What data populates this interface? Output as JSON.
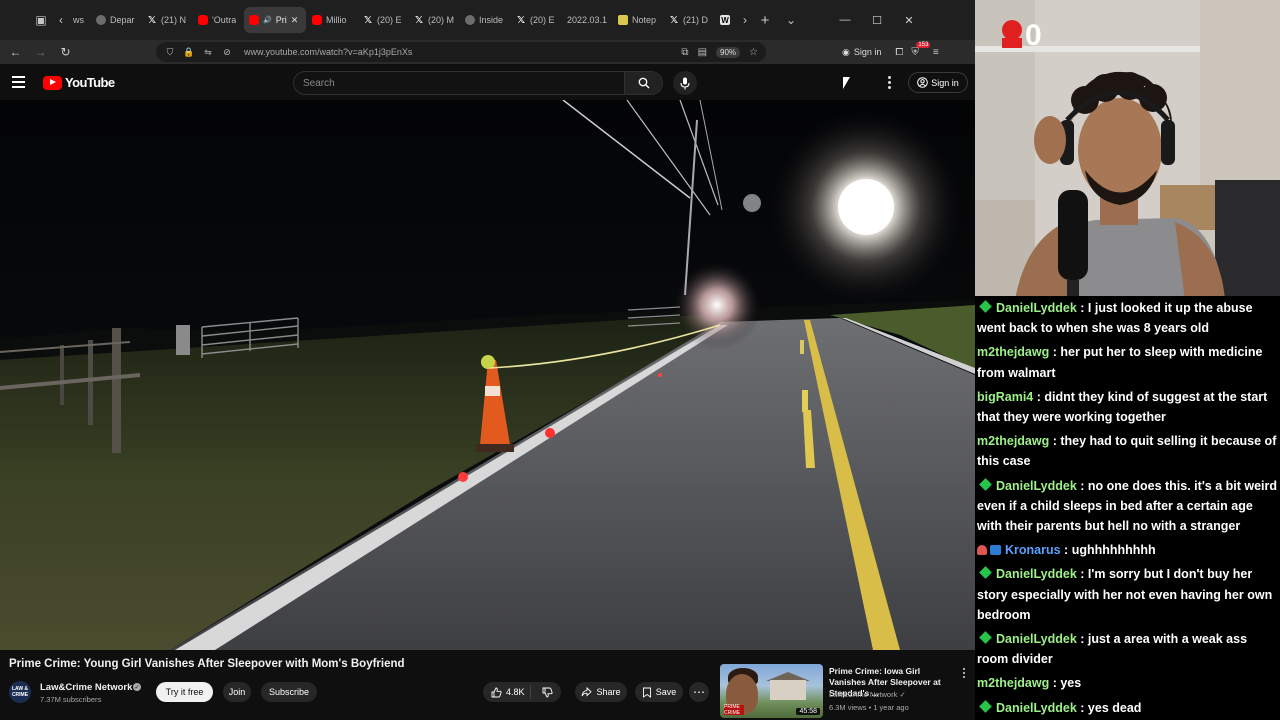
{
  "browser": {
    "tabs": [
      {
        "label": "ws",
        "icon": "chevron-left-icon",
        "active": false
      },
      {
        "label": "Depar",
        "icon": "generic-favicon",
        "active": false
      },
      {
        "label": "(21) N",
        "icon": "x-favicon",
        "active": false
      },
      {
        "label": "'Outra",
        "icon": "youtube-favicon",
        "active": false
      },
      {
        "label": "Pri",
        "icon": "youtube-favicon",
        "active": true
      },
      {
        "label": "Millio",
        "icon": "youtube-favicon",
        "active": false
      },
      {
        "label": "(20) E",
        "icon": "x-favicon",
        "active": false
      },
      {
        "label": "(20) M",
        "icon": "x-favicon",
        "active": false
      },
      {
        "label": "Inside",
        "icon": "generic-favicon",
        "active": false
      },
      {
        "label": "(20) E",
        "icon": "x-favicon",
        "active": false
      },
      {
        "label": "2022.03.1",
        "icon": "none",
        "active": false
      },
      {
        "label": "Notep",
        "icon": "note-favicon",
        "active": false
      },
      {
        "label": "(21) D",
        "icon": "x-favicon",
        "active": false
      },
      {
        "label": "",
        "icon": "w-favicon",
        "active": false
      }
    ],
    "url": "www.youtube.com/watch?v=aKp1j3pEnXs",
    "zoom": "90%",
    "signin_label": "Sign in",
    "extension_badge": "153"
  },
  "youtube": {
    "logo_text": "YouTube",
    "search_placeholder": "Search",
    "signin_label": "Sign in",
    "video": {
      "title": "Prime Crime: Young Girl Vanishes After Sleepover with Mom's Boyfriend",
      "channel": "Law&Crime Network",
      "subscribers": "7.37M subscribers",
      "channel_avatar_text": "LAW & CRIME",
      "try_free_label": "Try it free",
      "join_label": "Join",
      "subscribe_label": "Subscribe",
      "likes": "4.8K",
      "share_label": "Share",
      "save_label": "Save"
    },
    "recommended": {
      "title": "Prime Crime: Iowa Girl Vanishes After Sleepover at Stepdad's ...",
      "channel": "Law&Crime Network",
      "meta": "6.3M views • 1 year ago",
      "duration": "45:58",
      "badge": "PRIME CRIME"
    }
  },
  "webcam": {
    "overlay_number": "0"
  },
  "chat": {
    "messages": [
      {
        "user": "DanielLyddek",
        "color": "#9ef08a",
        "badge": "gem",
        "text": "I just looked it up the abuse went back to when she was 8 years old"
      },
      {
        "user": "m2thejdawg",
        "color": "#9ef08a",
        "badge": "none",
        "text": "her put her to sleep with medicine from walmart"
      },
      {
        "user": "bigRami4",
        "color": "#9ef08a",
        "badge": "none",
        "text": "didnt they kind of suggest at the start that they were working together"
      },
      {
        "user": "m2thejdawg",
        "color": "#9ef08a",
        "badge": "none",
        "text": "they had to quit selling it because of this case"
      },
      {
        "user": "DanielLyddek",
        "color": "#9ef08a",
        "badge": "gem",
        "text": "no one does this. it's a bit weird even if a child sleeps in bed after a certain age with their parents but hell no with a stranger"
      },
      {
        "user": "Kronarus",
        "color": "#5aa0ff",
        "badge": "sub",
        "text": "ughhhhhhhhh"
      },
      {
        "user": "DanielLyddek",
        "color": "#9ef08a",
        "badge": "gem",
        "text": "I'm sorry but I don't buy her story especially with her not even having her own bedroom"
      },
      {
        "user": "DanielLyddek",
        "color": "#9ef08a",
        "badge": "gem",
        "text": "just a area with a weak ass room divider"
      },
      {
        "user": "m2thejdawg",
        "color": "#9ef08a",
        "badge": "none",
        "text": "yes"
      },
      {
        "user": "DanielLyddek",
        "color": "#9ef08a",
        "badge": "gem",
        "text": "yes dead"
      }
    ]
  },
  "colors": {
    "yt_red": "#ff0000",
    "chat_green": "#9ef08a",
    "chat_blue": "#5aa0ff",
    "gem_green": "#28c34a"
  }
}
